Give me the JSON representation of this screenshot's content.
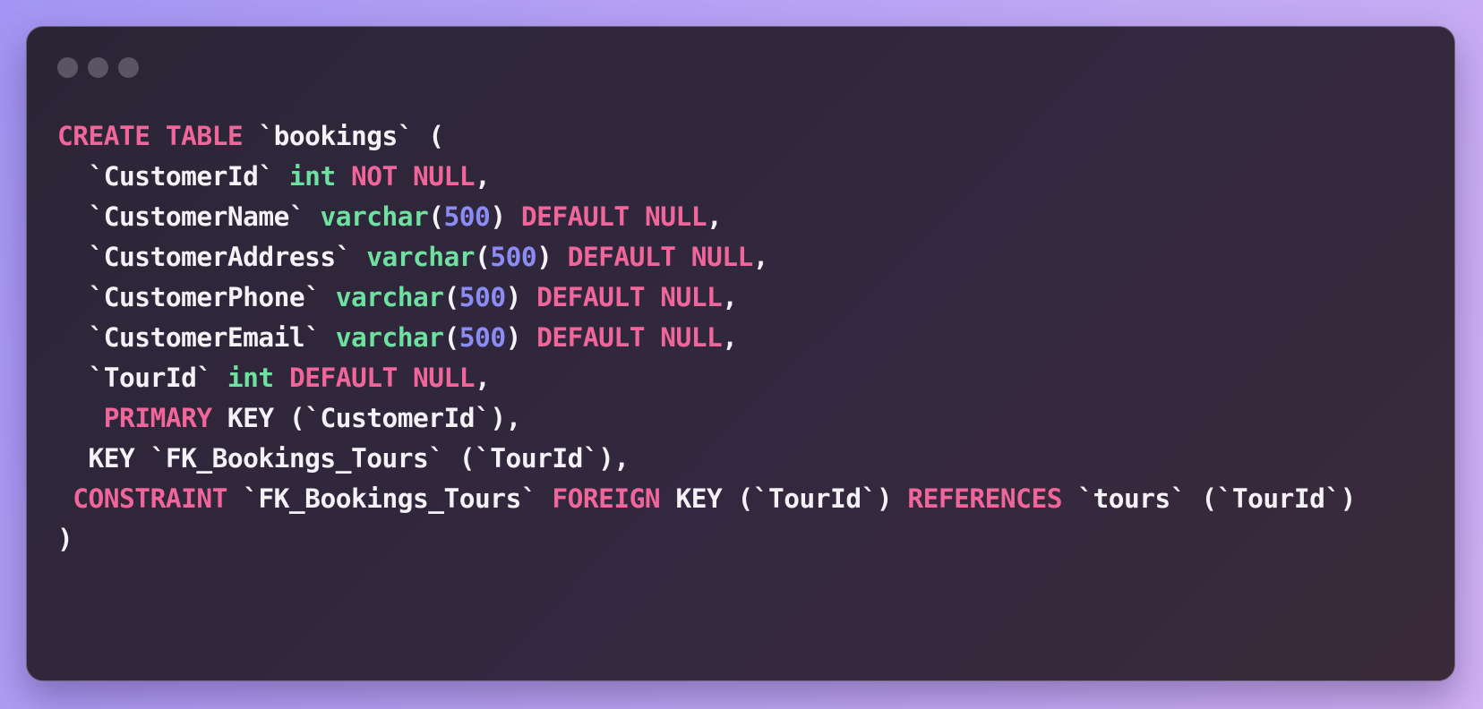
{
  "window": {
    "controls": [
      "close",
      "minimize",
      "zoom"
    ]
  },
  "code": {
    "language": "sql",
    "colors": {
      "keyword": "#f0669b",
      "type": "#6ee0a0",
      "number": "#8c8cf5",
      "plain": "#f4f2f7"
    },
    "lines": [
      [
        {
          "t": "kw",
          "v": "CREATE TABLE"
        },
        {
          "t": "pl",
          "v": " `bookings` ("
        }
      ],
      [
        {
          "t": "pl",
          "v": "  `CustomerId` "
        },
        {
          "t": "ty",
          "v": "int"
        },
        {
          "t": "pl",
          "v": " "
        },
        {
          "t": "kw",
          "v": "NOT NULL"
        },
        {
          "t": "pl",
          "v": ","
        }
      ],
      [
        {
          "t": "pl",
          "v": "  `CustomerName` "
        },
        {
          "t": "ty",
          "v": "varchar"
        },
        {
          "t": "pl",
          "v": "("
        },
        {
          "t": "num",
          "v": "500"
        },
        {
          "t": "pl",
          "v": ") "
        },
        {
          "t": "kw",
          "v": "DEFAULT NULL"
        },
        {
          "t": "pl",
          "v": ","
        }
      ],
      [
        {
          "t": "pl",
          "v": "  `CustomerAddress` "
        },
        {
          "t": "ty",
          "v": "varchar"
        },
        {
          "t": "pl",
          "v": "("
        },
        {
          "t": "num",
          "v": "500"
        },
        {
          "t": "pl",
          "v": ") "
        },
        {
          "t": "kw",
          "v": "DEFAULT NULL"
        },
        {
          "t": "pl",
          "v": ","
        }
      ],
      [
        {
          "t": "pl",
          "v": "  `CustomerPhone` "
        },
        {
          "t": "ty",
          "v": "varchar"
        },
        {
          "t": "pl",
          "v": "("
        },
        {
          "t": "num",
          "v": "500"
        },
        {
          "t": "pl",
          "v": ") "
        },
        {
          "t": "kw",
          "v": "DEFAULT NULL"
        },
        {
          "t": "pl",
          "v": ","
        }
      ],
      [
        {
          "t": "pl",
          "v": "  `CustomerEmail` "
        },
        {
          "t": "ty",
          "v": "varchar"
        },
        {
          "t": "pl",
          "v": "("
        },
        {
          "t": "num",
          "v": "500"
        },
        {
          "t": "pl",
          "v": ") "
        },
        {
          "t": "kw",
          "v": "DEFAULT NULL"
        },
        {
          "t": "pl",
          "v": ","
        }
      ],
      [
        {
          "t": "pl",
          "v": "  `TourId` "
        },
        {
          "t": "ty",
          "v": "int"
        },
        {
          "t": "pl",
          "v": " "
        },
        {
          "t": "kw",
          "v": "DEFAULT NULL"
        },
        {
          "t": "pl",
          "v": ","
        }
      ],
      [
        {
          "t": "pl",
          "v": "   "
        },
        {
          "t": "kw",
          "v": "PRIMARY"
        },
        {
          "t": "pl",
          "v": " KEY (`CustomerId`),"
        }
      ],
      [
        {
          "t": "pl",
          "v": "  KEY `FK_Bookings_Tours` (`TourId`),"
        }
      ],
      [
        {
          "t": "pl",
          "v": " "
        },
        {
          "t": "kw",
          "v": "CONSTRAINT"
        },
        {
          "t": "pl",
          "v": " `FK_Bookings_Tours` "
        },
        {
          "t": "kw",
          "v": "FOREIGN"
        },
        {
          "t": "pl",
          "v": " KEY (`TourId`) "
        },
        {
          "t": "kw",
          "v": "REFERENCES"
        },
        {
          "t": "pl",
          "v": " `tours` (`TourId`)"
        }
      ],
      [
        {
          "t": "pl",
          "v": ")"
        }
      ]
    ]
  }
}
